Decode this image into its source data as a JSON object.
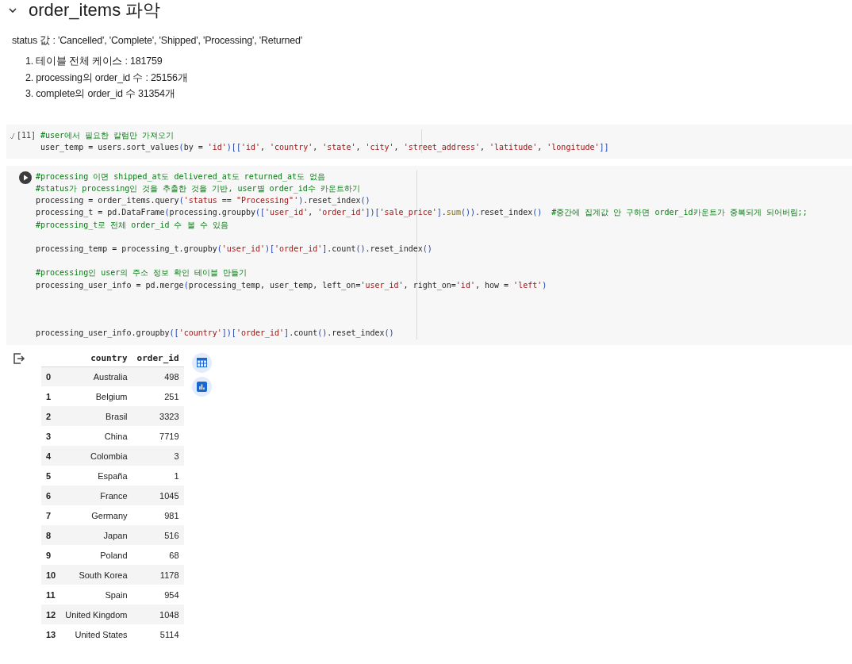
{
  "section": {
    "title": "order_items 파악",
    "expanded": true
  },
  "paragraph": "status 값 : 'Cancelled', 'Complete', 'Shipped', 'Processing', 'Returned'",
  "list_items": [
    "1. 테이블 전체 케이스 : 181759",
    "2. processing의 order_id 수 : 25156개",
    "3. complete의 order_id 수 31354개"
  ],
  "cells": [
    {
      "execution_count": "[11]",
      "lines": [
        {
          "kind": "code",
          "tokens": [
            {
              "kind": "comment",
              "text": "#user에서 필요한 칼럼만 가져오기"
            }
          ]
        },
        {
          "kind": "code",
          "tokens": [
            {
              "kind": "plain",
              "text": "user_temp = users.sort_values"
            },
            {
              "kind": "bracket",
              "text": "("
            },
            {
              "kind": "plain",
              "text": "by = "
            },
            {
              "kind": "string",
              "text": "'id'"
            },
            {
              "kind": "bracket",
              "text": ")[["
            },
            {
              "kind": "string",
              "text": "'id'"
            },
            {
              "kind": "plain",
              "text": ", "
            },
            {
              "kind": "string",
              "text": "'country'"
            },
            {
              "kind": "plain",
              "text": ", "
            },
            {
              "kind": "string",
              "text": "'state'"
            },
            {
              "kind": "plain",
              "text": ", "
            },
            {
              "kind": "string",
              "text": "'city'"
            },
            {
              "kind": "plain",
              "text": ", "
            },
            {
              "kind": "string",
              "text": "'street_address'"
            },
            {
              "kind": "plain",
              "text": ", "
            },
            {
              "kind": "string",
              "text": "'latitude'"
            },
            {
              "kind": "plain",
              "text": ", "
            },
            {
              "kind": "string",
              "text": "'longitude'"
            },
            {
              "kind": "bracket",
              "text": "]]"
            }
          ]
        }
      ]
    },
    {
      "lines": [
        {
          "kind": "code",
          "tokens": [
            {
              "kind": "comment",
              "text": "#processing 이면 shipped_at도 delivered_at도 returned_at도 없음"
            }
          ]
        },
        {
          "kind": "code",
          "tokens": [
            {
              "kind": "comment",
              "text": "#status가 processing인 것을 추출한 것을 기반, user별 order_id수 카운트하기"
            }
          ]
        },
        {
          "kind": "code",
          "tokens": [
            {
              "kind": "plain",
              "text": "processing = order_items.query"
            },
            {
              "kind": "bracket",
              "text": "("
            },
            {
              "kind": "string",
              "text": "'status == \"Processing\"'"
            },
            {
              "kind": "bracket",
              "text": ")"
            },
            {
              "kind": "plain",
              "text": ".reset_index"
            },
            {
              "kind": "bracket",
              "text": "()"
            }
          ]
        },
        {
          "kind": "code",
          "tokens": [
            {
              "kind": "plain",
              "text": "processing_t = pd.DataFrame"
            },
            {
              "kind": "bracket",
              "text": "("
            },
            {
              "kind": "plain",
              "text": "processing.groupby"
            },
            {
              "kind": "bracket",
              "text": "(["
            },
            {
              "kind": "string",
              "text": "'user_id'"
            },
            {
              "kind": "plain",
              "text": ", "
            },
            {
              "kind": "string",
              "text": "'order_id'"
            },
            {
              "kind": "bracket",
              "text": "])["
            },
            {
              "kind": "string",
              "text": "'sale_price'"
            },
            {
              "kind": "bracket",
              "text": "]"
            },
            {
              "kind": "plain",
              "text": "."
            },
            {
              "kind": "func",
              "text": "sum"
            },
            {
              "kind": "bracket",
              "text": "())"
            },
            {
              "kind": "plain",
              "text": ".reset_index"
            },
            {
              "kind": "bracket",
              "text": "()  "
            },
            {
              "kind": "comment",
              "text": "#중간에 집계값 안 구하면 order_id카운트가 중복되게 되어버림;;"
            }
          ]
        },
        {
          "kind": "code",
          "tokens": [
            {
              "kind": "comment",
              "text": "#processing_t로 전체 order_id 수 볼 수 있음"
            }
          ]
        },
        {
          "kind": "blank"
        },
        {
          "kind": "code",
          "tokens": [
            {
              "kind": "plain",
              "text": "processing_temp = processing_t.groupby"
            },
            {
              "kind": "bracket",
              "text": "("
            },
            {
              "kind": "string",
              "text": "'user_id'"
            },
            {
              "kind": "bracket",
              "text": ")["
            },
            {
              "kind": "string",
              "text": "'order_id'"
            },
            {
              "kind": "bracket",
              "text": "]"
            },
            {
              "kind": "plain",
              "text": ".count"
            },
            {
              "kind": "bracket",
              "text": "()"
            },
            {
              "kind": "plain",
              "text": ".reset_index"
            },
            {
              "kind": "bracket",
              "text": "()"
            }
          ]
        },
        {
          "kind": "blank"
        },
        {
          "kind": "code",
          "tokens": [
            {
              "kind": "comment",
              "text": "#processing인 user의 주소 정보 확인 테이블 만들기"
            }
          ]
        },
        {
          "kind": "code",
          "tokens": [
            {
              "kind": "plain",
              "text": "processing_user_info = pd.merge"
            },
            {
              "kind": "bracket",
              "text": "("
            },
            {
              "kind": "plain",
              "text": "processing_temp, user_temp, left_on="
            },
            {
              "kind": "string",
              "text": "'user_id'"
            },
            {
              "kind": "plain",
              "text": ", right_on="
            },
            {
              "kind": "string",
              "text": "'id'"
            },
            {
              "kind": "plain",
              "text": ", how = "
            },
            {
              "kind": "string",
              "text": "'left'"
            },
            {
              "kind": "bracket",
              "text": ")"
            }
          ]
        },
        {
          "kind": "blank"
        },
        {
          "kind": "blank"
        },
        {
          "kind": "blank"
        },
        {
          "kind": "code",
          "tokens": [
            {
              "kind": "plain",
              "text": "processing_user_info.groupby"
            },
            {
              "kind": "bracket",
              "text": "(["
            },
            {
              "kind": "string",
              "text": "'country'"
            },
            {
              "kind": "bracket",
              "text": "])["
            },
            {
              "kind": "string",
              "text": "'order_id'"
            },
            {
              "kind": "bracket",
              "text": "]"
            },
            {
              "kind": "plain",
              "text": ".count"
            },
            {
              "kind": "bracket",
              "text": "()"
            },
            {
              "kind": "plain",
              "text": ".reset_index"
            },
            {
              "kind": "bracket",
              "text": "()"
            }
          ]
        }
      ]
    }
  ],
  "output_table": {
    "columns": [
      "country",
      "order_id"
    ],
    "rows": [
      {
        "index": "0",
        "country": "Australia",
        "order_id": "498"
      },
      {
        "index": "1",
        "country": "Belgium",
        "order_id": "251"
      },
      {
        "index": "2",
        "country": "Brasil",
        "order_id": "3323"
      },
      {
        "index": "3",
        "country": "China",
        "order_id": "7719"
      },
      {
        "index": "4",
        "country": "Colombia",
        "order_id": "3"
      },
      {
        "index": "5",
        "country": "España",
        "order_id": "1"
      },
      {
        "index": "6",
        "country": "France",
        "order_id": "1045"
      },
      {
        "index": "7",
        "country": "Germany",
        "order_id": "981"
      },
      {
        "index": "8",
        "country": "Japan",
        "order_id": "516"
      },
      {
        "index": "9",
        "country": "Poland",
        "order_id": "68"
      },
      {
        "index": "10",
        "country": "South Korea",
        "order_id": "1178"
      },
      {
        "index": "11",
        "country": "Spain",
        "order_id": "954"
      },
      {
        "index": "12",
        "country": "United Kingdom",
        "order_id": "1048"
      },
      {
        "index": "13",
        "country": "United States",
        "order_id": "5114"
      }
    ]
  }
}
